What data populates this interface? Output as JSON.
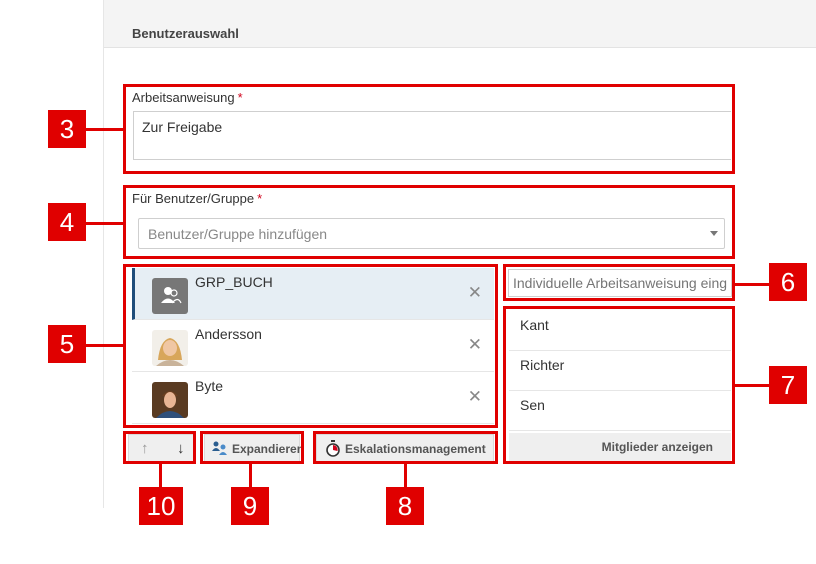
{
  "header": {
    "title": "Benutzerauswahl"
  },
  "instruction": {
    "label": "Arbeitsanweisung",
    "required_mark": "*",
    "value": "Zur Freigabe"
  },
  "user_group": {
    "label": "Für Benutzer/Gruppe",
    "required_mark": "*",
    "placeholder": "Benutzer/Gruppe hinzufügen"
  },
  "users": [
    {
      "name": "GRP_BUCH",
      "icon": "group-icon",
      "remove": "✕"
    },
    {
      "name": "Andersson",
      "icon": "avatar-photo",
      "remove": "✕"
    },
    {
      "name": "Byte",
      "icon": "avatar-photo",
      "remove": "✕"
    }
  ],
  "individual_instruction": {
    "placeholder": "Individuelle Arbeitsanweisung eing"
  },
  "members": {
    "items": [
      "Kant",
      "Richter",
      "Sen"
    ],
    "show_label": "Mitglieder anzeigen"
  },
  "toolbar": {
    "up_arrow": "↑",
    "down_arrow": "↓",
    "expand_label": "Expandieren",
    "escalation_label": "Eskalationsmanagement"
  },
  "callouts": {
    "c3": "3",
    "c4": "4",
    "c5": "5",
    "c6": "6",
    "c7": "7",
    "c8": "8",
    "c9": "9",
    "c10": "10"
  },
  "colors": {
    "annotation_red": "#e00000",
    "selected_row": "#e6eef4",
    "selected_accent": "#1f4d7a"
  }
}
